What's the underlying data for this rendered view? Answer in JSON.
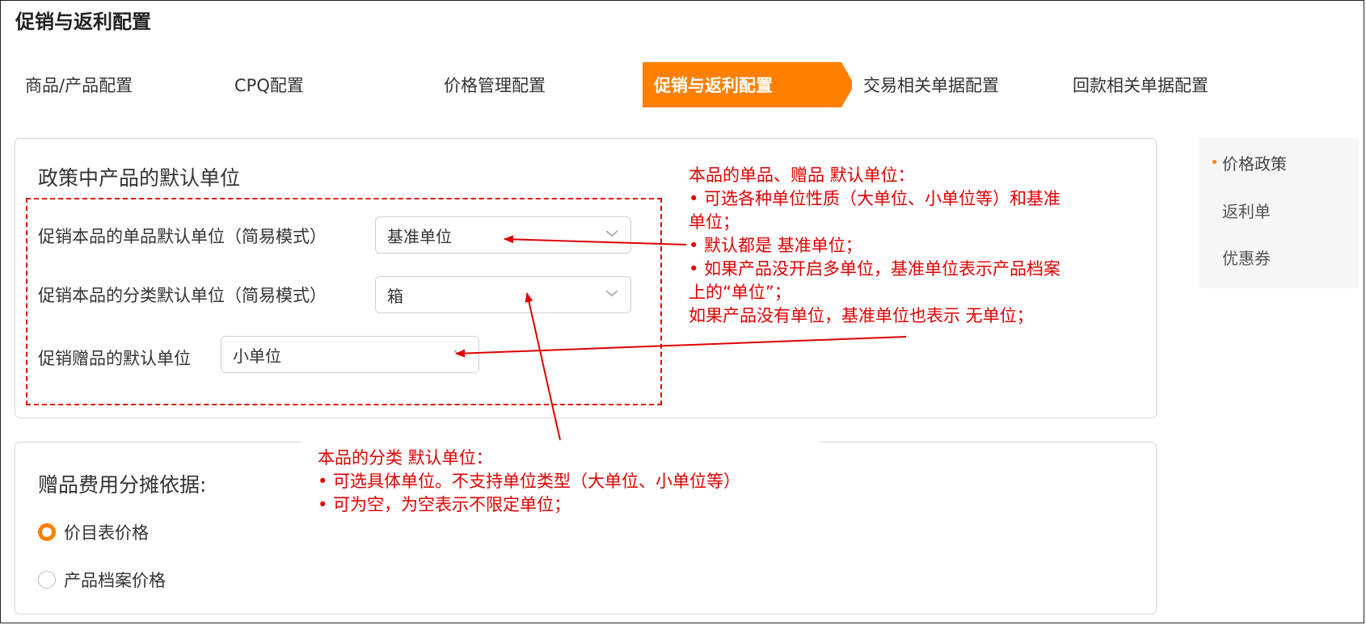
{
  "page": {
    "title": "促销与返利配置"
  },
  "steps": [
    {
      "label": "商品/产品配置",
      "active": false
    },
    {
      "label": "CPQ配置",
      "active": false
    },
    {
      "label": "价格管理配置",
      "active": false
    },
    {
      "label": "促销与返利配置",
      "active": true
    },
    {
      "label": "交易相关单据配置",
      "active": false
    },
    {
      "label": "回款相关单据配置",
      "active": false
    }
  ],
  "units_panel": {
    "title": "政策中产品的默认单位",
    "fields": [
      {
        "label": "促销本品的单品默认单位（简易模式）",
        "value": "基准单位"
      },
      {
        "label": "促销本品的分类默认单位（简易模式）",
        "value": "箱"
      },
      {
        "label": "促销赠品的默认单位",
        "value": "小单位"
      }
    ]
  },
  "cost_panel": {
    "title": "赠品费用分摊依据:",
    "options": [
      {
        "label": "价目表价格",
        "selected": true
      },
      {
        "label": "产品档案价格",
        "selected": false
      }
    ]
  },
  "side_nav": {
    "items": [
      {
        "label": "价格政策",
        "active": true
      },
      {
        "label": "返利单",
        "active": false
      },
      {
        "label": "优惠券",
        "active": false
      }
    ]
  },
  "annotations": {
    "right": [
      "本品的单品、赠品 默认单位：",
      "• 可选各种单位性质（大单位、小单位等）和基准",
      "单位；",
      "• 默认都是 基准单位；",
      "• 如果产品没开启多单位，基准单位表示产品档案",
      "上的“单位”；",
      "如果产品没有单位，基准单位也表示 无单位；"
    ],
    "bottom": [
      "本品的分类 默认单位：",
      "• 可选具体单位。不支持单位类型（大单位、小单位等）",
      "• 可为空，为空表示不限定单位；"
    ]
  },
  "colors": {
    "accent": "#ff8000",
    "annotation": "#e00000"
  }
}
